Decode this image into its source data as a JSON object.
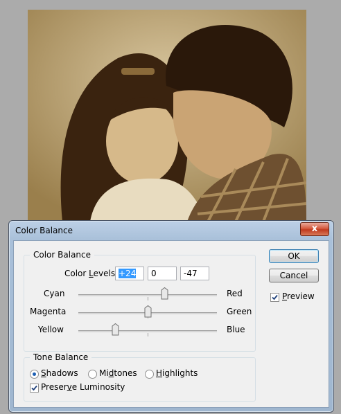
{
  "dialog": {
    "title": "Color Balance",
    "close_glyph": "x"
  },
  "color_balance": {
    "group_title": "Color Balance",
    "levels_label": "Color Levels:",
    "levels": [
      "+24",
      "0",
      "-47"
    ],
    "sliders": [
      {
        "left": "Cyan",
        "right": "Red",
        "value": 24
      },
      {
        "left": "Magenta",
        "right": "Green",
        "value": 0
      },
      {
        "left": "Yellow",
        "right": "Blue",
        "value": -47
      }
    ]
  },
  "tone_balance": {
    "group_title": "Tone Balance",
    "options": [
      "Shadows",
      "Midtones",
      "Highlights"
    ],
    "selected": "Shadows",
    "preserve_label": "Preserve Luminosity",
    "preserve_checked": true
  },
  "buttons": {
    "ok": "OK",
    "cancel": "Cancel"
  },
  "preview": {
    "label": "Preview",
    "checked": true
  },
  "colors": {
    "photo_tone": "#c2a56a",
    "dialog_frame": "#a9c0d9",
    "selection": "#3399ff"
  }
}
